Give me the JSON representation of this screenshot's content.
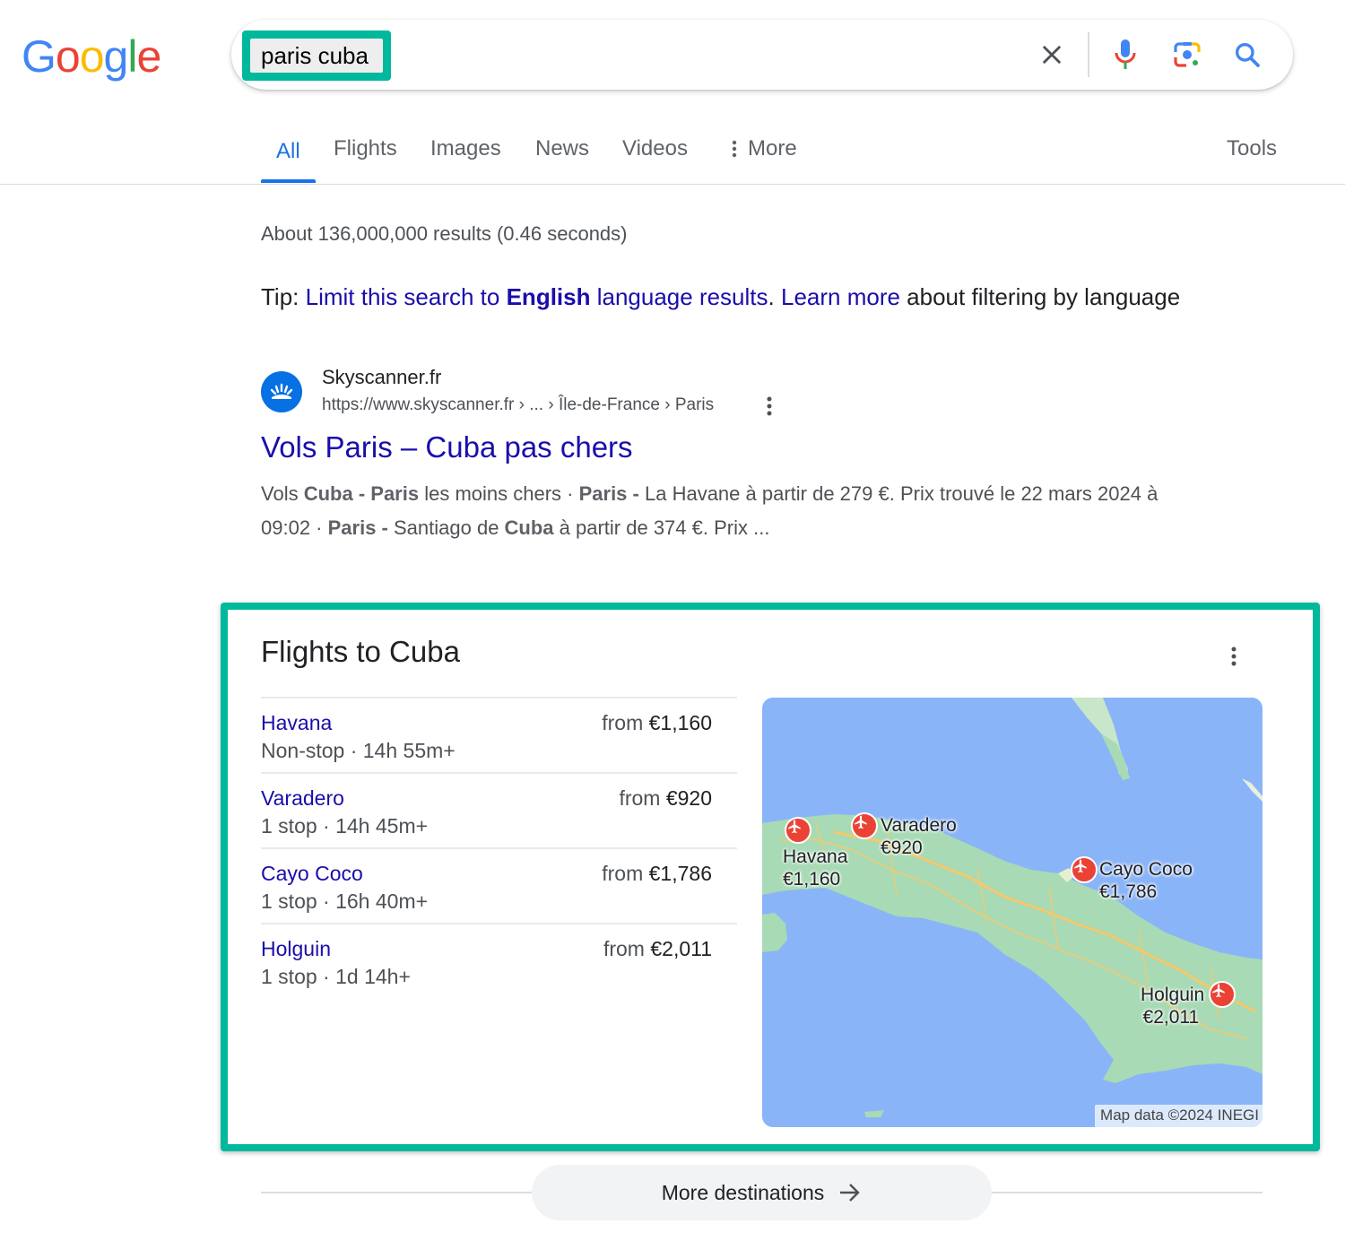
{
  "logo": {
    "letters": [
      "G",
      "o",
      "o",
      "g",
      "l",
      "e"
    ],
    "colors": [
      "#4285f4",
      "#ea4335",
      "#fbbc05",
      "#4285f4",
      "#34a853",
      "#ea4335"
    ]
  },
  "search": {
    "query": "paris cuba",
    "icons": [
      "clear-icon",
      "microphone-icon",
      "lens-camera-icon",
      "search-icon"
    ]
  },
  "tabs": [
    {
      "label": "All",
      "active": true
    },
    {
      "label": "Flights"
    },
    {
      "label": "Images"
    },
    {
      "label": "News"
    },
    {
      "label": "Videos"
    },
    {
      "label": "More",
      "icon": "vertical-dots-icon"
    }
  ],
  "tools_label": "Tools",
  "stats": "About 136,000,000 results (0.46 seconds)",
  "tip": {
    "prefix": "Tip: ",
    "link1_pre": "Limit this search to ",
    "link1_bold": "English",
    "link1_post": " language results",
    "sep": ". ",
    "link2": "Learn more",
    "suffix": " about filtering by language"
  },
  "result": {
    "site_name": "Skyscanner.fr",
    "url": "https://www.skyscanner.fr › ... › Île-de-France › Paris",
    "title": "Vols Paris – Cuba pas chers",
    "snippet": [
      {
        "t": "Vols ",
        "b": false
      },
      {
        "t": "Cuba",
        "b": true
      },
      {
        "t": " - ",
        "b": true
      },
      {
        "t": "Paris",
        "b": true
      },
      {
        "t": " les moins chers · ",
        "b": false
      },
      {
        "t": "Paris",
        "b": true
      },
      {
        "t": " - ",
        "b": true
      },
      {
        "t": "La Havane à partir de 279 €. Prix trouvé le 22 mars 2024 à 09:02 · ",
        "b": false
      },
      {
        "t": "Paris",
        "b": true
      },
      {
        "t": " - ",
        "b": true
      },
      {
        "t": "Santiago de ",
        "b": false
      },
      {
        "t": "Cuba",
        "b": true
      },
      {
        "t": " à partir de 374 €. Prix ...",
        "b": false
      }
    ]
  },
  "flights_card": {
    "title": "Flights to Cuba",
    "rows": [
      {
        "destination": "Havana",
        "info": "Non-stop · 14h 55m+",
        "from": "from ",
        "price": "€1,160"
      },
      {
        "destination": "Varadero",
        "info": "1 stop · 14h 45m+",
        "from": "from ",
        "price": "€920"
      },
      {
        "destination": "Cayo Coco",
        "info": "1 stop · 16h 40m+",
        "from": "from ",
        "price": "€1,786"
      },
      {
        "destination": "Holguin",
        "info": "1 stop · 1d 14h+",
        "from": "from ",
        "price": "€2,011"
      }
    ],
    "map": {
      "markers": [
        {
          "name": "Havana",
          "price": "€1,160"
        },
        {
          "name": "Varadero",
          "price": "€920"
        },
        {
          "name": "Cayo Coco",
          "price": "€1,786"
        },
        {
          "name": "Holguin",
          "price": "€2,011"
        }
      ],
      "attribution": "Map data ©2024 INEGI",
      "colors": {
        "water": "#8ab4f8",
        "land": "#a8dab5",
        "road": "#f6c86b",
        "marker": "#ea4335"
      }
    }
  },
  "more_destinations": "More destinations"
}
